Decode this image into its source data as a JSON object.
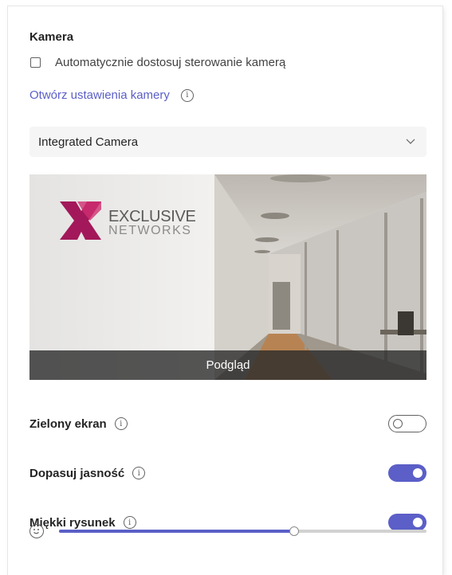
{
  "camera": {
    "section_title": "Kamera",
    "auto_adjust_label": "Automatycznie dostosuj sterowanie kamerą",
    "auto_adjust_checked": false,
    "open_settings_link": "Otwórz ustawienia kamery",
    "selected_camera": "Integrated Camera",
    "preview_label": "Podgląd",
    "preview_logo": {
      "line1": "EXCLUSIVE",
      "line2": "NETWORKS"
    }
  },
  "settings": [
    {
      "label": "Zielony ekran",
      "enabled": false
    },
    {
      "label": "Dopasuj jasność",
      "enabled": true
    },
    {
      "label": "Miękki rysunek",
      "enabled": true
    }
  ],
  "soft_focus_level": 0.64,
  "colors": {
    "accent": "#5b5fc7",
    "text": "#242424",
    "link": "#5b5fc7",
    "track": "#d1d1d1"
  }
}
